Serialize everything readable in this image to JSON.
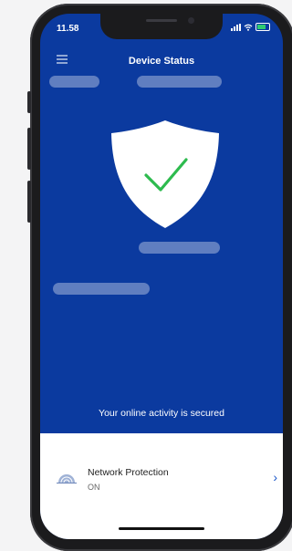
{
  "status_bar": {
    "time": "11.58"
  },
  "header": {
    "title": "Device Status"
  },
  "main": {
    "shield_icon": "shield-check-icon",
    "secured_message": "Your online activity is secured"
  },
  "network_protection": {
    "label": "Network Protection",
    "status": "ON",
    "icon": "network-icon"
  },
  "colors": {
    "primary": "#0b3a9f",
    "check": "#2dbb4e",
    "chevron": "#1a56c9"
  }
}
